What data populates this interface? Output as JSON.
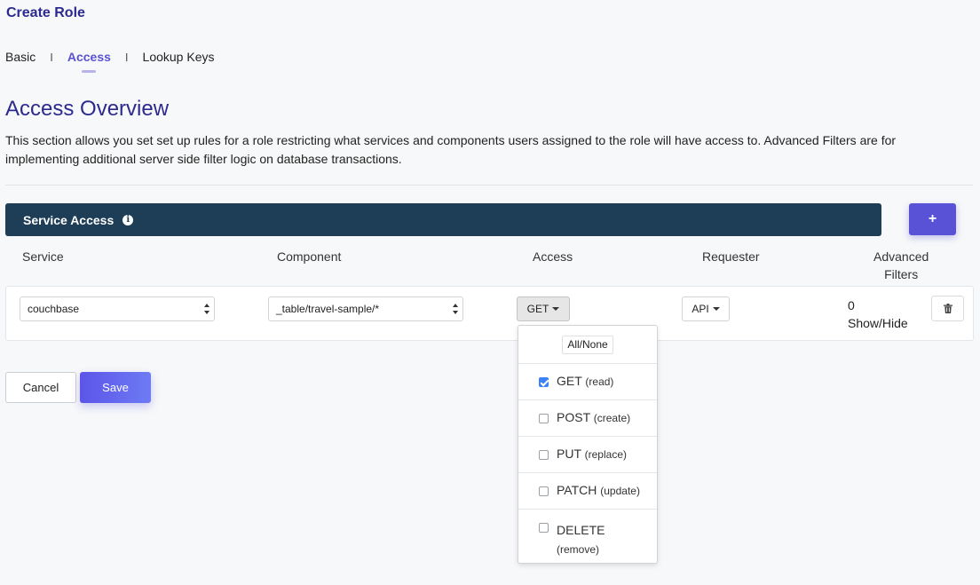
{
  "page_title": "Create Role",
  "tabs": [
    {
      "label": "Basic",
      "active": false
    },
    {
      "label": "Access",
      "active": true
    },
    {
      "label": "Lookup Keys",
      "active": false
    }
  ],
  "tab_separator": "I",
  "section": {
    "title": "Access Overview",
    "description": "This section allows you set set up rules for a role restricting what services and components users assigned to the role will have access to. Advanced Filters are for implementing additional server side filter logic on database transactions."
  },
  "service_access": {
    "title": "Service Access",
    "info_icon": "info-circle-icon",
    "add_label": "+",
    "columns": {
      "service": "Service",
      "component": "Component",
      "access": "Access",
      "requester": "Requester",
      "advanced_filters_line1": "Advanced",
      "advanced_filters_line2": "Filters"
    },
    "rows": [
      {
        "service": "couchbase",
        "component": "_table/travel-sample/*",
        "access": "GET",
        "requester": "API",
        "advanced_filters_count": "0",
        "show_hide": "Show/Hide",
        "delete_icon": "trash-icon"
      }
    ]
  },
  "access_menu": {
    "all_none": "All/None",
    "options": [
      {
        "verb": "GET",
        "desc": "(read)",
        "checked": true
      },
      {
        "verb": "POST",
        "desc": "(create)",
        "checked": false
      },
      {
        "verb": "PUT",
        "desc": "(replace)",
        "checked": false
      },
      {
        "verb": "PATCH",
        "desc": "(update)",
        "checked": false
      },
      {
        "verb": "DELETE",
        "desc": "(remove)",
        "checked": false
      }
    ]
  },
  "actions": {
    "cancel": "Cancel",
    "save": "Save"
  },
  "colors": {
    "title": "#2c2a8f",
    "accent": "#5a52d6",
    "bar": "#1e3e57",
    "checkbox": "#3b82f6"
  }
}
